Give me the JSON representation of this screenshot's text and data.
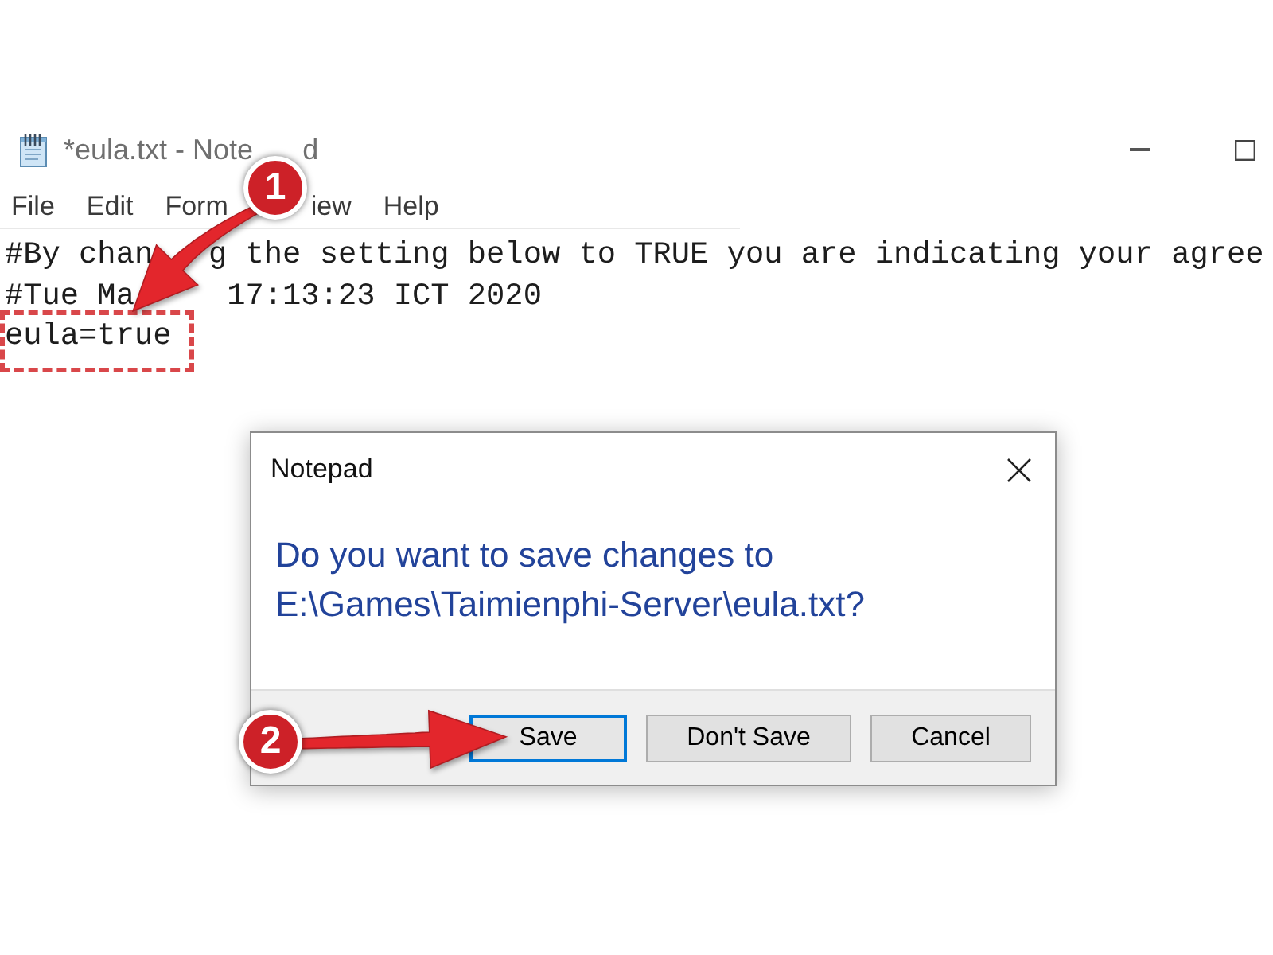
{
  "window": {
    "title_parts": [
      "*eula.txt - Note",
      "d"
    ]
  },
  "menu": [
    "File",
    "Edit",
    "Form",
    "iew",
    "Help"
  ],
  "editor": {
    "lines": [
      {
        "parts": [
          "#By chan",
          "g the setting below to TRUE you are indicating your agree"
        ],
        "highlighted": false
      },
      {
        "parts": [
          "#Tue Ma",
          "17:13:23 ICT 2020"
        ],
        "highlighted": false
      },
      {
        "parts": [
          "eula=true"
        ],
        "highlighted": true
      }
    ]
  },
  "dialog": {
    "title": "Notepad",
    "message": "Do you want to save changes to E:\\Games\\Taimienphi-Server\\eula.txt?",
    "buttons": [
      {
        "label": "Save",
        "focused": true
      },
      {
        "label": "Don't Save",
        "focused": false
      },
      {
        "label": "Cancel",
        "focused": false
      }
    ]
  },
  "callouts": [
    {
      "number": "1"
    },
    {
      "number": "2"
    }
  ]
}
